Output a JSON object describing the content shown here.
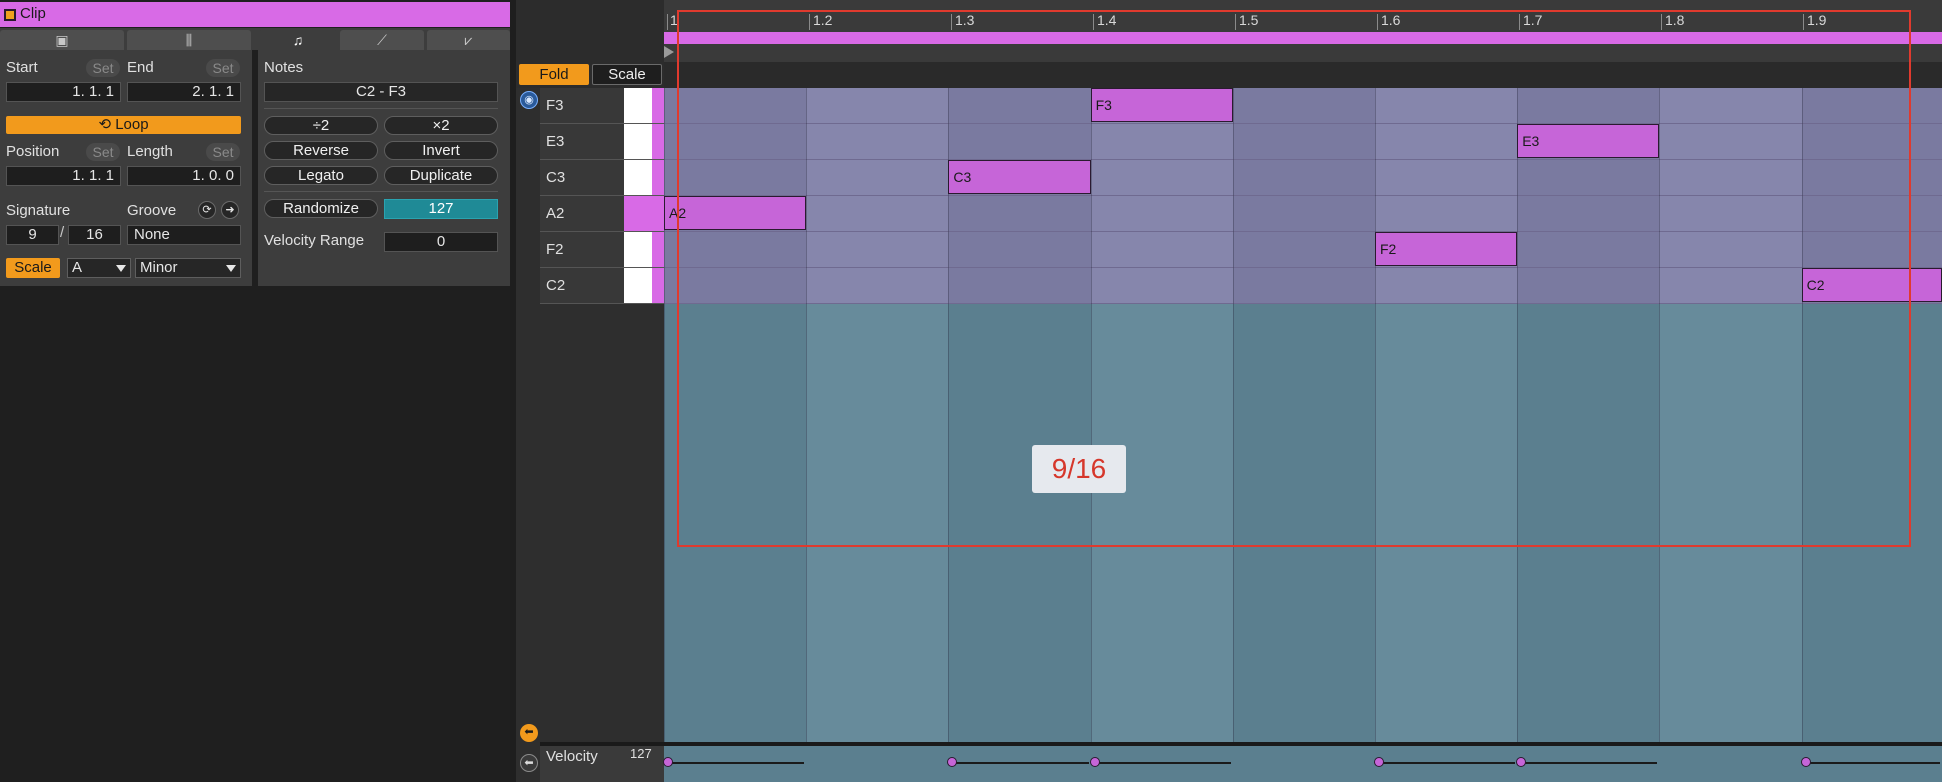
{
  "clip": {
    "title": "Clip",
    "colors": {
      "clip": "#d86ae6",
      "accent": "#f29a1c",
      "teal": "#1f8a96"
    },
    "tabs": [
      {
        "icon": "play-square-icon",
        "glyph": "▣"
      },
      {
        "icon": "envelope-bars-icon",
        "glyph": "⫼"
      },
      {
        "icon": "note-icon",
        "glyph": "♫"
      },
      {
        "icon": "mpe-icon",
        "glyph": "⟋"
      },
      {
        "icon": "transform-icon",
        "glyph": "⩗"
      }
    ],
    "start": {
      "label": "Start",
      "value": "1.   1.   1",
      "set": "Set"
    },
    "end": {
      "label": "End",
      "value": "2.   1.   1",
      "set": "Set"
    },
    "loop": {
      "label": "Loop",
      "glyph": "⟲"
    },
    "position": {
      "label": "Position",
      "value": "1.   1.   1",
      "set": "Set"
    },
    "length": {
      "label": "Length",
      "value": "1.   0.   0",
      "set": "Set"
    },
    "signature": {
      "label": "Signature",
      "numerator": "9",
      "denominator": "16"
    },
    "groove": {
      "label": "Groove",
      "value": "None",
      "icon1": "⟳",
      "icon2": "➜"
    },
    "scale": {
      "label": "Scale",
      "root": "A",
      "mode": "Minor"
    }
  },
  "notes_panel": {
    "label": "Notes",
    "range": "C2 - F3",
    "buttons": {
      "div2": "÷2",
      "mul2": "×2",
      "reverse": "Reverse",
      "invert": "Invert",
      "legato": "Legato",
      "duplicate": "Duplicate",
      "randomize": "Randomize"
    },
    "randomize_value": "127",
    "velocity_range_label": "Velocity Range",
    "velocity_range_value": "0"
  },
  "editor": {
    "fold": "Fold",
    "scale": "Scale",
    "ruler": [
      "1",
      "1.2",
      "1.3",
      "1.4",
      "1.5",
      "1.6",
      "1.7",
      "1.8",
      "1.9"
    ],
    "keys": [
      {
        "name": "F3"
      },
      {
        "name": "E3"
      },
      {
        "name": "C3"
      },
      {
        "name": "A2"
      },
      {
        "name": "F2"
      },
      {
        "name": "C2"
      }
    ],
    "notes": [
      {
        "pitch": "F3",
        "row": 0,
        "start": 4,
        "length": 1,
        "label": "F3"
      },
      {
        "pitch": "E3",
        "row": 1,
        "start": 7,
        "length": 1,
        "label": "E3"
      },
      {
        "pitch": "C3",
        "row": 2,
        "start": 3,
        "length": 1,
        "label": "C3"
      },
      {
        "pitch": "A2",
        "row": 3,
        "start": 1,
        "length": 1,
        "label": "A2"
      },
      {
        "pitch": "F2",
        "row": 4,
        "start": 6,
        "length": 1,
        "label": "F2"
      },
      {
        "pitch": "C2",
        "row": 5,
        "start": 9,
        "length": 1,
        "label": "C2"
      }
    ],
    "overlay": {
      "fraction": "9/16"
    },
    "velocity": {
      "label": "Velocity",
      "max": "127"
    }
  }
}
